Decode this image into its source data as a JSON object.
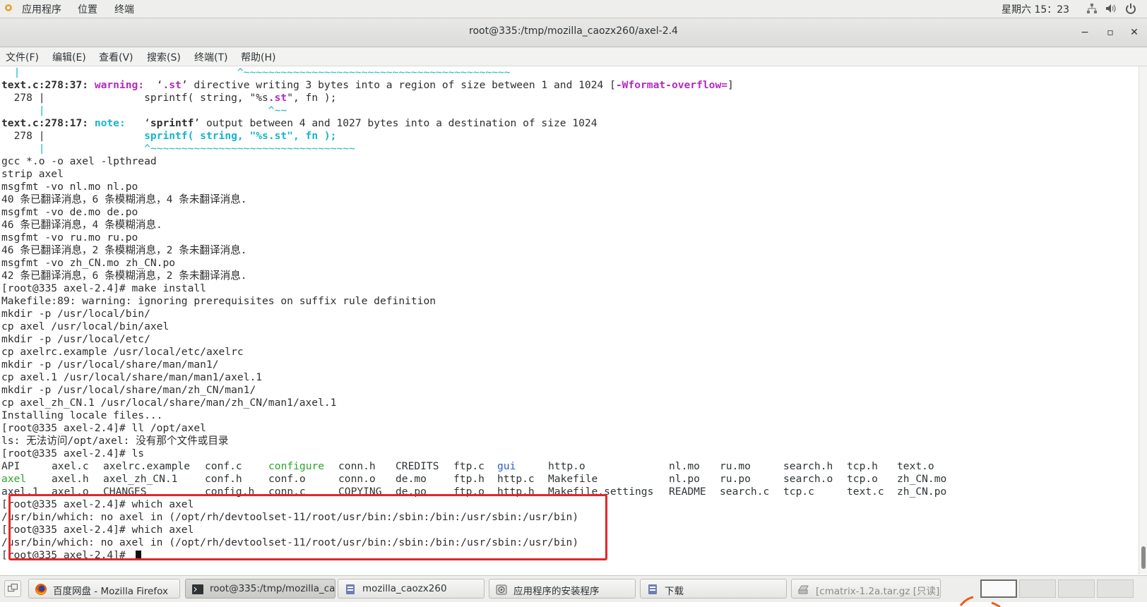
{
  "panel": {
    "apps": "应用程序",
    "places": "位置",
    "terminal": "终端",
    "clock": "星期六 15：23"
  },
  "window": {
    "title": "root@335:/tmp/mozilla_caozx260/axel-2.4",
    "minimize": "−",
    "maximize": "▫",
    "close": "✕"
  },
  "menu": [
    "文件(F)",
    "编辑(E)",
    "查看(V)",
    "搜索(S)",
    "终端(T)",
    "帮助(H)"
  ],
  "terminal": {
    "l0_gutter": "  |                                   ^~~~~~~~~~~~~~~~~~~~~~~~~~~~~~~~~~~~~~~~~~~~",
    "l1_file": "text.c:",
    "l1_pos": "278:37: ",
    "l1_warning": "warning: ",
    "l1_q1": " ‘",
    "l1_st": ".st",
    "l1_msg": "’ directive writing 3 bytes into a region of size between 1 and 1024 [",
    "l1_flag": "-Wformat-overflow=",
    "l1_end": "]",
    "l2_num": "  278 |                ",
    "l2_code1": "sprintf( string, \"%s",
    "l2_st": ".st",
    "l2_code2": "\", fn );",
    "l3": "      |                                    ^~~",
    "l4_file": "text.c:",
    "l4_pos": "278:17: ",
    "l4_note": "note: ",
    "l4_q1": "  ‘",
    "l4_fn": "sprintf",
    "l4_msg": "’ output between 4 and 1027 bytes into a destination of size 1024",
    "l5_num": "  278 |                ",
    "l5_code": "sprintf( string, \"%s.st\", fn );",
    "l6": "      |                ^~~~~~~~~~~~~~~~~~~~~~~~~~~~~~~~~~",
    "l7": "gcc *.o -o axel -lpthread",
    "l8": "strip axel",
    "l9": "msgfmt -vo nl.mo nl.po",
    "l10": "40 条已翻译消息，6 条模糊消息，4 条未翻译消息.",
    "l11": "msgfmt -vo de.mo de.po",
    "l12": "46 条已翻译消息，4 条模糊消息.",
    "l13": "msgfmt -vo ru.mo ru.po",
    "l14": "46 条已翻译消息，2 条模糊消息，2 条未翻译消息.",
    "l15": "msgfmt -vo zh_CN.mo zh_CN.po",
    "l16": "42 条已翻译消息，6 条模糊消息，2 条未翻译消息.",
    "l17": "[root@335 axel-2.4]# make install",
    "l18": "Makefile:89: warning: ignoring prerequisites on suffix rule definition",
    "l19": "mkdir -p /usr/local/bin/",
    "l20": "cp axel /usr/local/bin/axel",
    "l21": "mkdir -p /usr/local/etc/",
    "l22": "cp axelrc.example /usr/local/etc/axelrc",
    "l23": "mkdir -p /usr/local/share/man/man1/",
    "l24": "cp axel.1 /usr/local/share/man/man1/axel.1",
    "l25": "mkdir -p /usr/local/share/man/zh_CN/man1/",
    "l26": "cp axel_zh_CN.1 /usr/local/share/man/zh_CN/man1/axel.1",
    "l27": "Installing locale files...",
    "l28": "[root@335 axel-2.4]# ll /opt/axel",
    "l29": "ls: 无法访问/opt/axel: 没有那个文件或目录",
    "l30": "[root@335 axel-2.4]# ls",
    "ls_row1": [
      "API",
      "axel.c",
      "axelrc.example",
      "conf.c",
      "configure",
      "conn.h",
      "CREDITS",
      "ftp.c",
      "gui",
      "http.o",
      "nl.mo",
      "ru.mo",
      "search.h",
      "tcp.h",
      "text.o"
    ],
    "ls_row2": [
      "axel",
      "axel.h",
      "axel_zh_CN.1",
      "conf.h",
      "conf.o",
      "conn.o",
      "de.mo",
      "ftp.h",
      "http.c",
      "Makefile",
      "nl.po",
      "ru.po",
      "search.o",
      "tcp.o",
      "zh_CN.mo"
    ],
    "ls_row3": [
      "axel.1",
      "axel.o",
      "CHANGES",
      "config.h",
      "conn.c",
      "COPYING",
      "de.po",
      "ftp.o",
      "http.h",
      "Makefile.settings",
      "README",
      "search.c",
      "tcp.c",
      "text.c",
      "zh_CN.po"
    ],
    "l34": "[root@335 axel-2.4]# which axel",
    "l35": "/usr/bin/which: no axel in (/opt/rh/devtoolset-11/root/usr/bin:/sbin:/bin:/usr/sbin:/usr/bin)",
    "l36": "[root@335 axel-2.4]# which axel",
    "l37": "/usr/bin/which: no axel in (/opt/rh/devtoolset-11/root/usr/bin:/sbin:/bin:/usr/sbin:/usr/bin)",
    "l38": "[root@335 axel-2.4]# "
  },
  "taskbar": {
    "items": [
      {
        "label": "百度网盘 - Mozilla Firefox",
        "icon": "firefox-icon"
      },
      {
        "label": "root@335:/tmp/mozilla_ca···",
        "icon": "terminal-icon"
      },
      {
        "label": "mozilla_caozx260",
        "icon": "folder-icon"
      },
      {
        "label": "应用程序的安装程序",
        "icon": "installer-icon"
      },
      {
        "label": "下载",
        "icon": "folder-icon"
      },
      {
        "label": "[cmatrix-1.2a.tar.gz [只读]]",
        "icon": "archive-icon"
      }
    ]
  },
  "colors": {
    "highlight": "#e3262a",
    "warning": "#b12dbd",
    "note": "#16b6c8",
    "executable": "#2aa52a",
    "directory": "#2a5fc8"
  }
}
